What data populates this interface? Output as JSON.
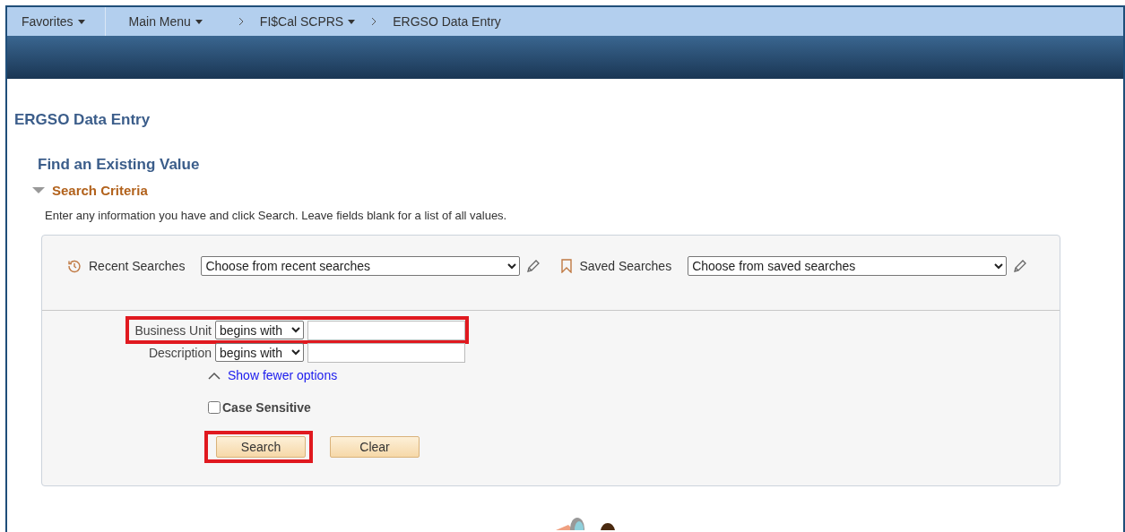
{
  "nav": {
    "favorites": "Favorites",
    "main_menu": "Main Menu",
    "breadcrumbs": [
      {
        "label": "FI$Cal SCPRS",
        "dropdown": true
      },
      {
        "label": "ERGSO Data Entry",
        "dropdown": false
      }
    ]
  },
  "page_title": "ERGSO Data Entry",
  "heading": "Find an Existing Value",
  "section": {
    "label": "Search Criteria",
    "expanded": true
  },
  "instructions": "Enter any information you have and click Search. Leave fields blank for a list of all values.",
  "recent": {
    "label": "Recent Searches",
    "placeholder": "Choose from recent searches"
  },
  "saved": {
    "label": "Saved Searches",
    "placeholder": "Choose from saved searches"
  },
  "fields": [
    {
      "label": "Business Unit",
      "operator": "begins with",
      "highlighted": true
    },
    {
      "label": "Description",
      "operator": "begins with",
      "highlighted": false
    }
  ],
  "options_link": "Show fewer options",
  "case_sensitive": {
    "label": "Case Sensitive",
    "checked": false
  },
  "buttons": [
    {
      "label": "Search",
      "highlighted": true
    },
    {
      "label": "Clear",
      "highlighted": false
    }
  ]
}
